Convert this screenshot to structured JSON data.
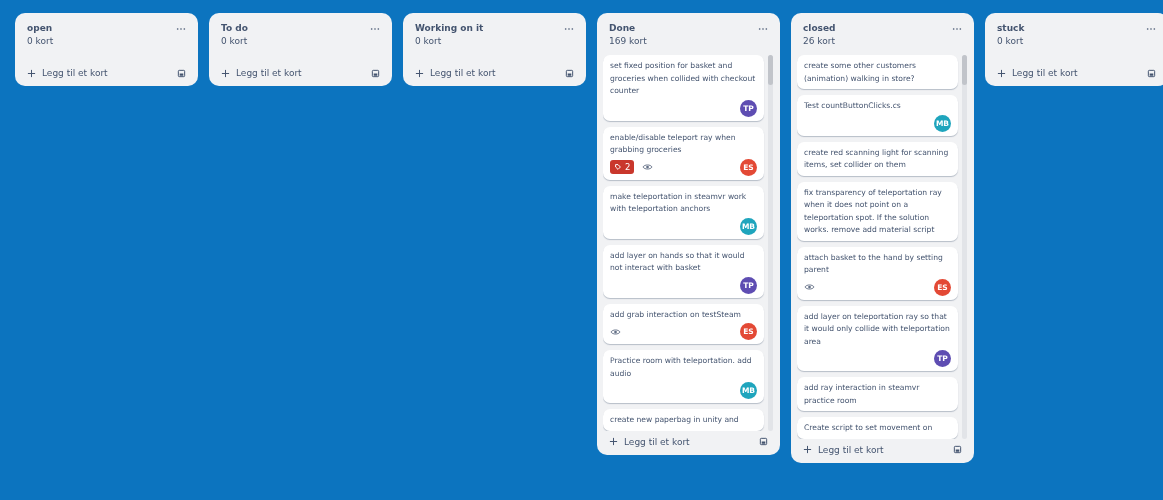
{
  "lists": [
    {
      "title": "open",
      "count": "0 kort",
      "add_label": "Legg til et kort"
    },
    {
      "title": "To do",
      "count": "0 kort",
      "add_label": "Legg til et kort"
    },
    {
      "title": "Working on it",
      "count": "0 kort",
      "add_label": "Legg til et kort"
    },
    {
      "title": "Done",
      "count": "169 kort",
      "add_label": "Legg til et kort",
      "cards": [
        {
          "text": "set fixed position for basket and groceries when collided with checkout counter",
          "watching": false,
          "member": {
            "initials": "TP",
            "color": "#5e4db2"
          }
        },
        {
          "text": "enable/disable teleport ray when grabbing groceries",
          "badge": "2",
          "watching": true,
          "member": {
            "initials": "ES",
            "color": "#e34935"
          }
        },
        {
          "text": "make teleportation in steamvr work with teleportation anchors",
          "watching": false,
          "member": {
            "initials": "MB",
            "color": "#1fa5bd"
          }
        },
        {
          "text": "add layer on hands so that it would not interact with basket",
          "watching": false,
          "member": {
            "initials": "TP",
            "color": "#5e4db2"
          }
        },
        {
          "text": "add grab interaction on testSteam",
          "watching": true,
          "member": {
            "initials": "ES",
            "color": "#e34935"
          }
        },
        {
          "text": "Practice room with teleportation. add audio",
          "watching": false,
          "member": {
            "initials": "MB",
            "color": "#1fa5bd"
          }
        },
        {
          "text": "create new paperbag in unity and",
          "watching": false
        }
      ]
    },
    {
      "title": "closed",
      "count": "26 kort",
      "add_label": "Legg til et kort",
      "cards": [
        {
          "text": "create some other customers (animation) walking in store?",
          "watching": false
        },
        {
          "text": "Test countButtonClicks.cs",
          "watching": false,
          "member": {
            "initials": "MB",
            "color": "#1fa5bd"
          }
        },
        {
          "text": "create red scanning light for scanning items, set collider on them",
          "watching": false
        },
        {
          "text": "fix transparency of teleportation ray when it does not point on a teleportation spot. If the solution works. remove add material script",
          "watching": false
        },
        {
          "text": "attach basket to the hand by setting parent",
          "watching": true,
          "member": {
            "initials": "ES",
            "color": "#e34935"
          }
        },
        {
          "text": "add layer on teleportation ray so that it would only collide with teleportation area",
          "watching": false,
          "member": {
            "initials": "TP",
            "color": "#5e4db2"
          }
        },
        {
          "text": "add ray interaction in steamvr practice room",
          "watching": false
        },
        {
          "text": "Create script to set movement on",
          "watching": false
        }
      ]
    },
    {
      "title": "stuck",
      "count": "0 kort",
      "add_label": "Legg til et kort"
    }
  ]
}
